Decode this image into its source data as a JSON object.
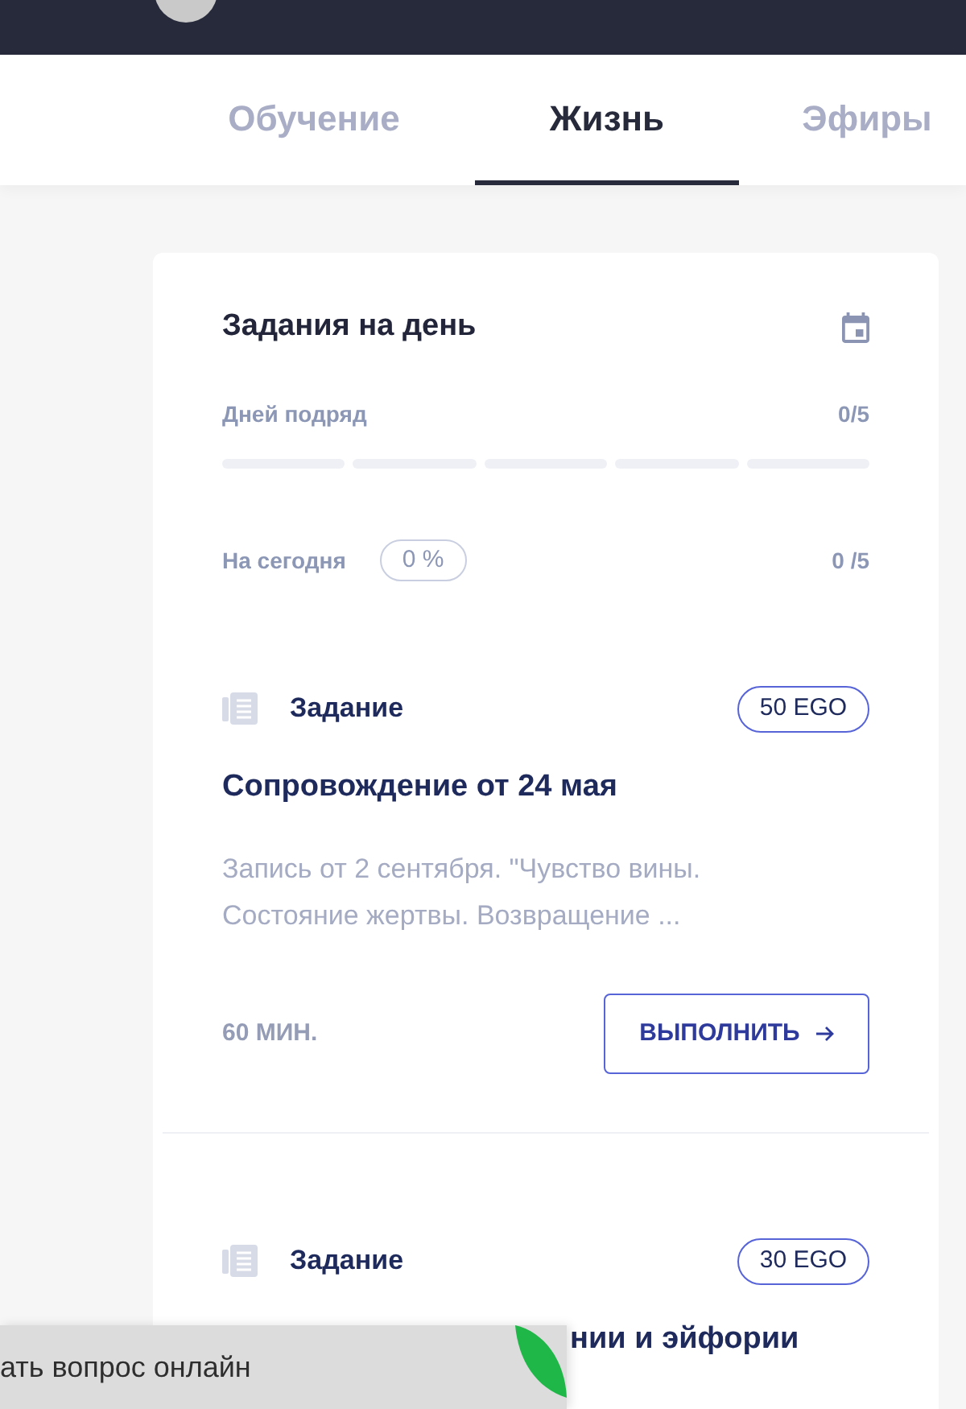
{
  "tabs": [
    {
      "label": "Обучение",
      "selected": false
    },
    {
      "label": "Жизнь",
      "selected": true
    },
    {
      "label": "Эфиры",
      "selected": false
    }
  ],
  "daily_tasks": {
    "title": "Задания на день",
    "streak": {
      "label": "Дней подряд",
      "count": "0/5",
      "segments": [
        {
          "filled": false
        },
        {
          "filled": false
        },
        {
          "filled": false
        },
        {
          "filled": false
        },
        {
          "filled": false
        }
      ]
    },
    "today": {
      "label": "На сегодня",
      "percent": "0 %",
      "count": "0 /5"
    }
  },
  "tasks": [
    {
      "type_label": "Задание",
      "reward": "50 EGO",
      "title": "Сопровождение от 24 мая",
      "description": "Запись от 2 сентября. \"Чувство вины. Состояние жертвы. Возвращение ...",
      "duration": "60 МИН.",
      "action": "ВЫПОЛНИТЬ"
    },
    {
      "type_label": "Задание",
      "reward": "30 EGO",
      "title": "нии и эйфории"
    }
  ],
  "chat_button": {
    "label": "ать вопрос онлайн"
  }
}
